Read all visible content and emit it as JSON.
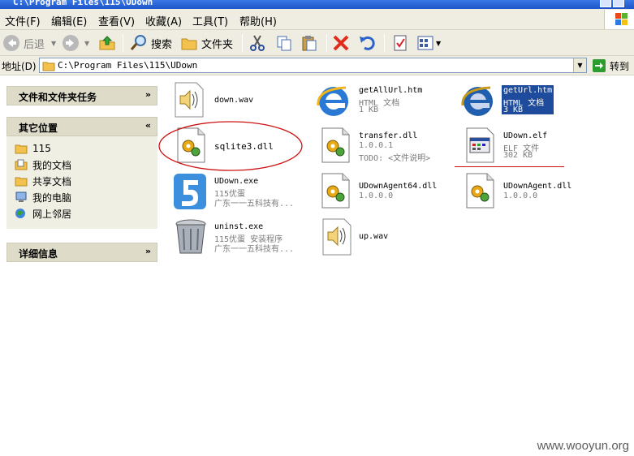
{
  "window": {
    "title": "C:\\Program Files\\115\\UDown"
  },
  "menu": [
    {
      "label": "文件(F)"
    },
    {
      "label": "编辑(E)"
    },
    {
      "label": "查看(V)"
    },
    {
      "label": "收藏(A)"
    },
    {
      "label": "工具(T)"
    },
    {
      "label": "帮助(H)"
    }
  ],
  "toolbar": {
    "back_label": "后退",
    "search_label": "搜索",
    "folders_label": "文件夹"
  },
  "address": {
    "label": "地址(D)",
    "value": "C:\\Program Files\\115\\UDown",
    "go_label": "转到"
  },
  "sidebar": {
    "tasks_title": "文件和文件夹任务",
    "places_title": "其它位置",
    "places": [
      {
        "label": "115",
        "icon": "folder-icon"
      },
      {
        "label": "我的文档",
        "icon": "documents-icon"
      },
      {
        "label": "共享文档",
        "icon": "folder-icon"
      },
      {
        "label": "我的电脑",
        "icon": "computer-icon"
      },
      {
        "label": "网上邻居",
        "icon": "network-icon"
      }
    ],
    "details_title": "详细信息"
  },
  "files": [
    {
      "name": "down.wav",
      "line2": "",
      "line3": "",
      "icon": "sound-icon"
    },
    {
      "name": "getAllUrl.htm",
      "line2": "HTML 文档",
      "line3": "1 KB",
      "icon": "ie-icon"
    },
    {
      "name": "getUrl.htm",
      "line2": "HTML 文档",
      "line3": "3 KB",
      "icon": "ie-icon",
      "selected": true
    },
    {
      "name": "sqlite3.dll",
      "line2": "",
      "line3": "",
      "icon": "dll-icon",
      "circled": true
    },
    {
      "name": "transfer.dll",
      "line2": "1.0.0.1",
      "line3": "TODO: <文件说明>",
      "icon": "dll-icon"
    },
    {
      "name": "UDown.elf",
      "line2": "ELF 文件",
      "line3": "302 KB",
      "icon": "elf-icon",
      "underlined": true
    },
    {
      "name": "UDown.exe",
      "line2": "115优蛋",
      "line3": "广东一一五科技有...",
      "icon": "udown-icon"
    },
    {
      "name": "UDownAgent64.dll",
      "line2": "1.0.0.0",
      "line3": "",
      "icon": "dll-icon"
    },
    {
      "name": "UDownAgent.dll",
      "line2": "1.0.0.0",
      "line3": "",
      "icon": "dll-icon"
    },
    {
      "name": "uninst.exe",
      "line2": "115优蛋 安装程序",
      "line3": "广东一一五科技有...",
      "icon": "recycle-icon"
    },
    {
      "name": "up.wav",
      "line2": "",
      "line3": "",
      "icon": "sound-icon"
    }
  ],
  "watermark": "www.wooyun.org",
  "colors": {
    "accent": "#1f4b9c",
    "annotation": "#cc1111",
    "chrome": "#efede2"
  }
}
